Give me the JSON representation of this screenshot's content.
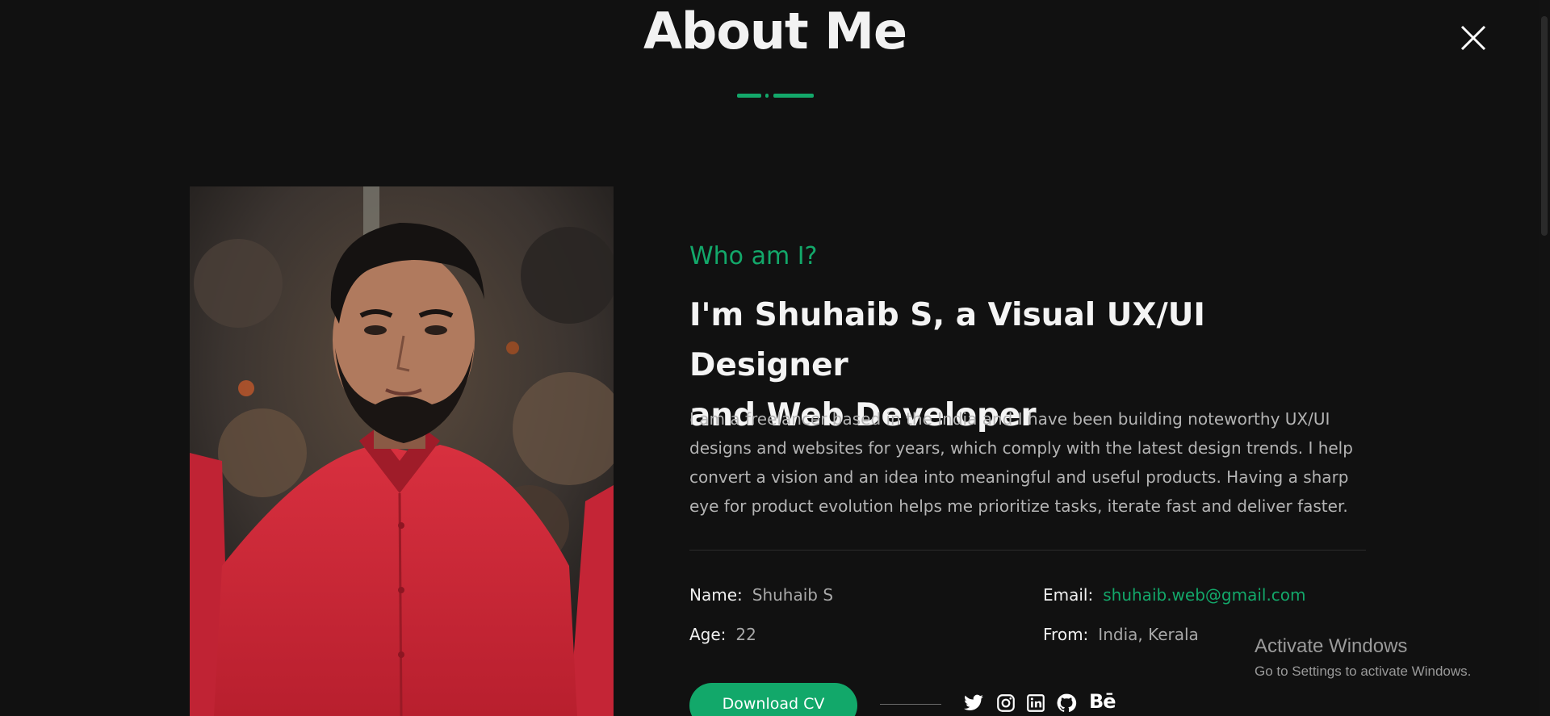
{
  "header": {
    "title": "About Me"
  },
  "accent_color": "#13a86a",
  "background_color": "#111111",
  "intro": {
    "eyebrow": "Who am I?",
    "headline_line1": "I'm Shuhaib S, a Visual UX/UI Designer",
    "headline_line2": "and Web Developer",
    "bio": "I am a freelancer based in the India and I have been building noteworthy UX/UI designs and websites for years, which comply with the latest design trends. I help convert a vision and an idea into meaningful and useful products. Having a sharp eye for product evolution helps me prioritize tasks, iterate fast and deliver faster."
  },
  "details": {
    "name_label": "Name:",
    "name_value": "Shuhaib S",
    "email_label": "Email:",
    "email_value": "shuhaib.web@gmail.com",
    "age_label": "Age:",
    "age_value": "22",
    "from_label": "From:",
    "from_value": "India, Kerala"
  },
  "actions": {
    "download_cv": "Download CV"
  },
  "social": [
    "twitter-icon",
    "instagram-icon",
    "linkedin-icon",
    "github-icon",
    "behance-icon"
  ],
  "behance_glyph": "Bē",
  "windows_watermark": {
    "title": "Activate Windows",
    "subtitle": "Go to Settings to activate Windows."
  }
}
